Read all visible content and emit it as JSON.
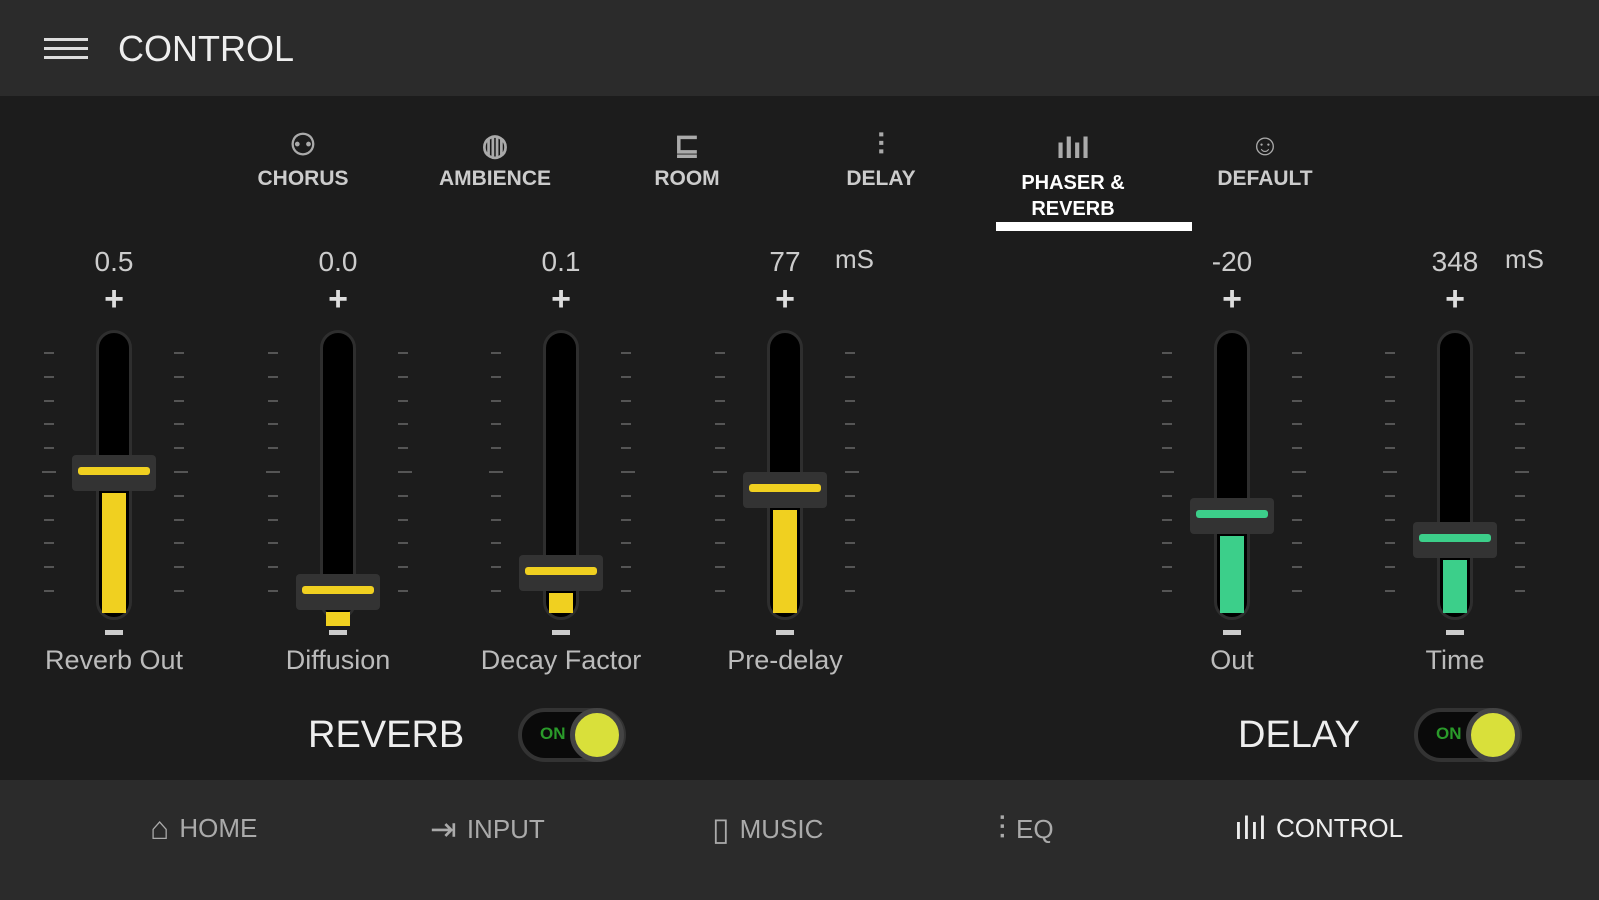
{
  "header": {
    "title": "CONTROL",
    "menu_icon": "hamburger-icon"
  },
  "tabs": [
    {
      "label": "CHORUS",
      "icon": "people-icon",
      "glyph": "⚇"
    },
    {
      "label": "AMBIENCE",
      "icon": "globe-icon",
      "glyph": "◍"
    },
    {
      "label": "ROOM",
      "icon": "chair-icon",
      "glyph": "⊑"
    },
    {
      "label": "DELAY",
      "icon": "sliders-icon",
      "glyph": "⫶"
    },
    {
      "label": "PHASER & REVERB",
      "icon": "waveform-icon",
      "glyph": "ılıl",
      "active": true
    },
    {
      "label": "DEFAULT",
      "icon": "face-icon",
      "glyph": "☺"
    }
  ],
  "sliders": [
    {
      "label": "Reverb Out",
      "value": "0.5",
      "unit": "",
      "level": 0.5,
      "color": "#f0d020"
    },
    {
      "label": "Diffusion",
      "value": "0.0",
      "unit": "",
      "level": 0.0,
      "color": "#f0d020"
    },
    {
      "label": "Decay Factor",
      "value": "0.1",
      "unit": "",
      "level": 0.08,
      "color": "#f0d020"
    },
    {
      "label": "Pre-delay",
      "value": "77",
      "unit": "mS",
      "level": 0.43,
      "color": "#f0d020"
    },
    {
      "label": "Out",
      "value": "-20",
      "unit": "",
      "level": 0.32,
      "color": "#3ccf8a"
    },
    {
      "label": "Time",
      "value": "348",
      "unit": "mS",
      "level": 0.22,
      "color": "#3ccf8a"
    }
  ],
  "groups": {
    "reverb": {
      "label": "REVERB",
      "toggle": "ON"
    },
    "delay": {
      "label": "DELAY",
      "toggle": "ON"
    }
  },
  "nav": [
    {
      "label": "HOME",
      "icon": "home-icon",
      "glyph": "⌂"
    },
    {
      "label": "INPUT",
      "icon": "input-icon",
      "glyph": "⇥"
    },
    {
      "label": "MUSIC",
      "icon": "speaker-icon",
      "glyph": "▯"
    },
    {
      "label": "EQ",
      "icon": "eq-icon",
      "glyph": "⫶"
    },
    {
      "label": "CONTROL",
      "icon": "waveform-icon",
      "glyph": "ılıl",
      "active": true
    }
  ]
}
